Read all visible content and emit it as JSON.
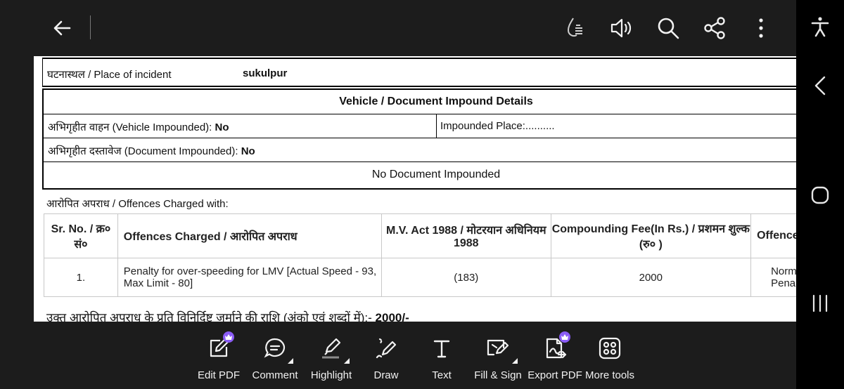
{
  "toolbar": {
    "icons": [
      "back-arrow-icon",
      "liquid-mode-icon",
      "read-aloud-icon",
      "search-icon",
      "share-icon",
      "more-options-icon"
    ]
  },
  "document": {
    "place_label": "घटनास्थल / Place of incident",
    "place_value": "sukulpur",
    "impound": {
      "title": "Vehicle / Document Impound Details",
      "vehicle_label": "अभिगृहीत वाहन (Vehicle Impounded): ",
      "vehicle_value": "No",
      "place_label": "Impounded Place:..........",
      "document_label": "अभिगृहीत दस्तावेज (Document Impounded): ",
      "document_value": "No",
      "note": "No Document Impounded"
    },
    "offences_heading": "आरोपित अपराध / Offences Charged with:",
    "table": {
      "headers": [
        "Sr. No. / क्र० सं०",
        "Offences Charged / आरोपित अपराध",
        "M.V. Act 1988 / मोटरयान अधिनियम 1988",
        "Compounding Fee(In Rs.) / प्रशमन शुल्क (रु० )",
        "Offence Type"
      ],
      "row": {
        "sr": "1.",
        "offence": "Penalty for over-speeding for LMV [Actual Speed - 93, Max Limit - 80]",
        "act": "(183)",
        "fee": "2000",
        "type": "Normal Penalty"
      }
    },
    "summary_label": "उक्त आरोपित अपराध के प्रति विनिर्दिष्ट जुर्माने की राशि (अंको एवं शब्दों में):- ",
    "summary_value": "2000/-"
  },
  "bottom_tools": [
    {
      "label": "Edit PDF",
      "icon": "edit-pdf-icon",
      "premium": true
    },
    {
      "label": "Comment",
      "icon": "comment-icon",
      "premium": false
    },
    {
      "label": "Highlight",
      "icon": "highlight-icon",
      "premium": false
    },
    {
      "label": "Draw",
      "icon": "draw-icon",
      "premium": false
    },
    {
      "label": "Text",
      "icon": "text-icon",
      "premium": false
    },
    {
      "label": "Fill & Sign",
      "icon": "fill-sign-icon",
      "premium": false
    },
    {
      "label": "Export PDF",
      "icon": "export-pdf-icon",
      "premium": true
    },
    {
      "label": "More tools",
      "icon": "more-tools-icon",
      "premium": false
    }
  ],
  "system_nav": [
    "accessibility-icon",
    "nav-back-icon",
    "nav-home-icon",
    "nav-recents-icon"
  ],
  "colors": {
    "premium_badge": "#8b5cf6",
    "app_bg": "#1c1c1c"
  }
}
